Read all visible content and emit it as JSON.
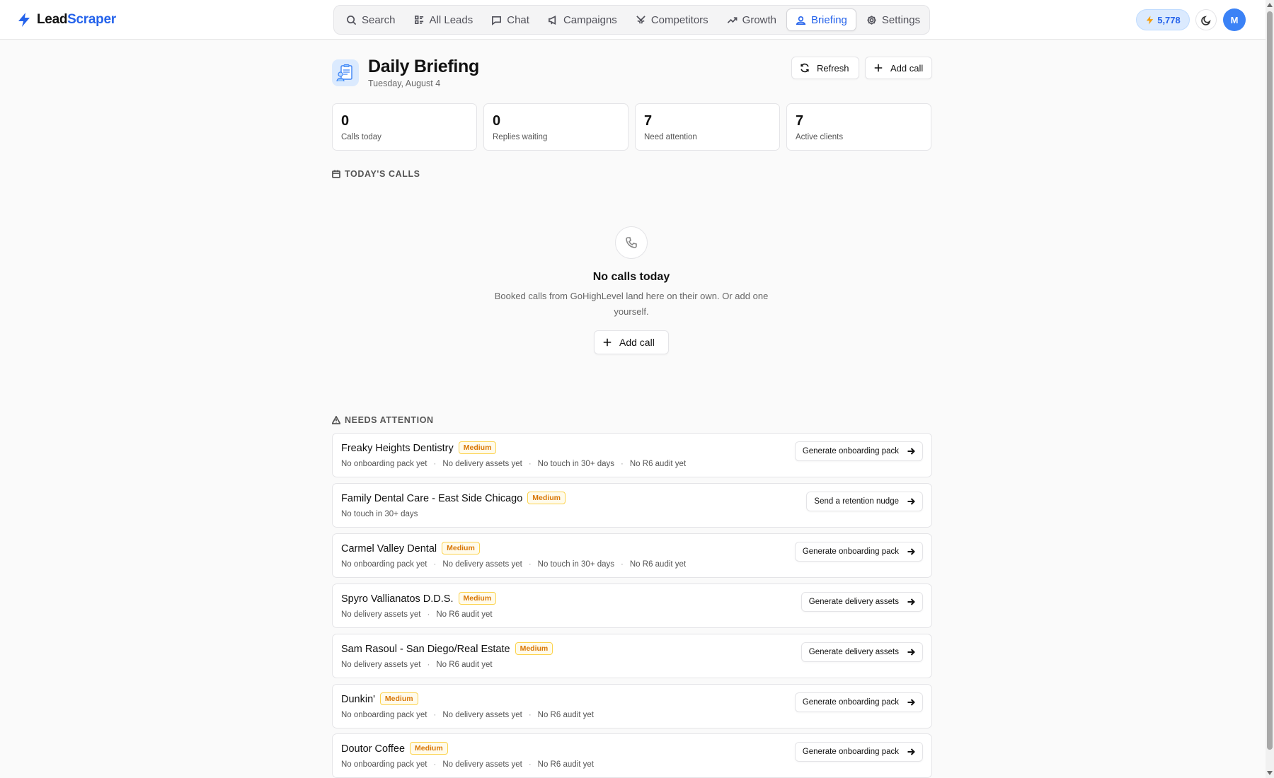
{
  "app": {
    "logo_part1": "Lead",
    "logo_part2": "Scraper",
    "brand_color": "#2563eb"
  },
  "nav": [
    {
      "label": "Search",
      "icon": "search-icon",
      "active": false
    },
    {
      "label": "All Leads",
      "icon": "list-icon",
      "active": false
    },
    {
      "label": "Chat",
      "icon": "chat-icon",
      "active": false
    },
    {
      "label": "Campaigns",
      "icon": "megaphone-icon",
      "active": false
    },
    {
      "label": "Competitors",
      "icon": "swords-icon",
      "active": false
    },
    {
      "label": "Growth",
      "icon": "trending-up-icon",
      "active": false
    },
    {
      "label": "Briefing",
      "icon": "briefing-icon",
      "active": true
    },
    {
      "label": "Settings",
      "icon": "gear-icon",
      "active": false
    }
  ],
  "header_right": {
    "credits": "5,778",
    "avatar_initial": "M"
  },
  "page": {
    "title": "Daily Briefing",
    "date": "Tuesday, August 4",
    "refresh_label": "Refresh",
    "add_call_label": "Add call"
  },
  "stats": [
    {
      "value": "0",
      "label": "Calls today"
    },
    {
      "value": "0",
      "label": "Replies waiting"
    },
    {
      "value": "7",
      "label": "Need attention"
    },
    {
      "value": "7",
      "label": "Active clients"
    }
  ],
  "todays_calls": {
    "title": "TODAY'S CALLS",
    "empty_title": "No calls today",
    "empty_desc": "Booked calls from GoHighLevel land here on their own. Or add one yourself.",
    "add_call_label": "Add call"
  },
  "needs_attention": {
    "title": "NEEDS ATTENTION",
    "items": [
      {
        "name": "Freaky Heights Dentistry",
        "priority": "Medium",
        "issues": [
          "No onboarding pack yet",
          "No delivery assets yet",
          "No touch in 30+ days",
          "No R6 audit yet"
        ],
        "action": "Generate onboarding pack"
      },
      {
        "name": "Family Dental Care - East Side Chicago",
        "priority": "Medium",
        "issues": [
          "No touch in 30+ days"
        ],
        "action": "Send a retention nudge"
      },
      {
        "name": "Carmel Valley Dental",
        "priority": "Medium",
        "issues": [
          "No onboarding pack yet",
          "No delivery assets yet",
          "No touch in 30+ days",
          "No R6 audit yet"
        ],
        "action": "Generate onboarding pack"
      },
      {
        "name": "Spyro Vallianatos D.D.S.",
        "priority": "Medium",
        "issues": [
          "No delivery assets yet",
          "No R6 audit yet"
        ],
        "action": "Generate delivery assets"
      },
      {
        "name": "Sam Rasoul - San Diego/Real Estate",
        "priority": "Medium",
        "issues": [
          "No delivery assets yet",
          "No R6 audit yet"
        ],
        "action": "Generate delivery assets"
      },
      {
        "name": "Dunkin'",
        "priority": "Medium",
        "issues": [
          "No onboarding pack yet",
          "No delivery assets yet",
          "No R6 audit yet"
        ],
        "action": "Generate onboarding pack"
      },
      {
        "name": "Doutor Coffee",
        "priority": "Medium",
        "issues": [
          "No onboarding pack yet",
          "No delivery assets yet",
          "No R6 audit yet"
        ],
        "action": "Generate onboarding pack"
      }
    ]
  },
  "colors": {
    "accent": "#2563eb",
    "badge_text": "#d97706",
    "badge_border": "#fcd34d"
  }
}
